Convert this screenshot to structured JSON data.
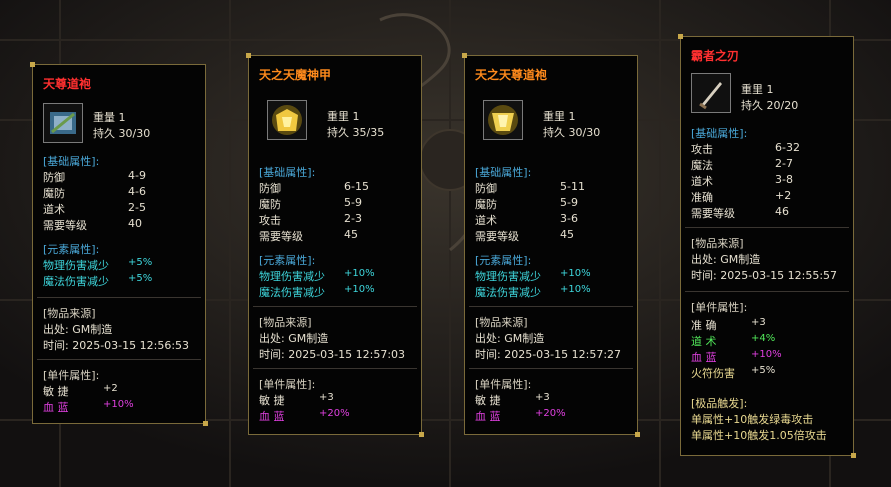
{
  "cards": [
    {
      "title": "天尊道袍",
      "weight": "重量 1",
      "durability": "持久 30/30",
      "base_header": "[基础属性]:",
      "base": [
        {
          "k": "防御",
          "v": "4-9"
        },
        {
          "k": "魔防",
          "v": "4-6"
        },
        {
          "k": "道术",
          "v": "2-5"
        },
        {
          "k": "需要等级",
          "v": "40"
        }
      ],
      "elem_header": "[元素属性]:",
      "elem": [
        {
          "k": "物理伤害减少",
          "v": "+5%"
        },
        {
          "k": "魔法伤害减少",
          "v": "+5%"
        }
      ],
      "source_header": "[物品来源]",
      "source_from": "出处: GM制造",
      "source_time": "时间: 2025-03-15 12:56:53",
      "single_header": "[单件属性]:",
      "single": [
        {
          "k": "敏 捷",
          "v": "+2"
        },
        {
          "k": "血 蓝",
          "v": "+10%"
        }
      ]
    },
    {
      "title": "天之天魔神甲",
      "weight": "重里 1",
      "durability": "持久 35/35",
      "base_header": "[基础属性]:",
      "base": [
        {
          "k": "防御",
          "v": "6-15"
        },
        {
          "k": "魔防",
          "v": "5-9"
        },
        {
          "k": "攻击",
          "v": "2-3"
        },
        {
          "k": "需要等级",
          "v": "45"
        }
      ],
      "elem_header": "[元素属性]:",
      "elem": [
        {
          "k": "物理伤害减少",
          "v": "+10%"
        },
        {
          "k": "魔法伤害减少",
          "v": "+10%"
        }
      ],
      "source_header": "[物品来源]",
      "source_from": "出处: GM制造",
      "source_time": "时间: 2025-03-15 12:57:03",
      "single_header": "[单件属性]:",
      "single": [
        {
          "k": "敏 捷",
          "v": "+3"
        },
        {
          "k": "血 蓝",
          "v": "+20%"
        }
      ]
    },
    {
      "title": "天之天尊道袍",
      "weight": "重里 1",
      "durability": "持久 30/30",
      "base_header": "[基础属性]:",
      "base": [
        {
          "k": "防御",
          "v": "5-11"
        },
        {
          "k": "魔防",
          "v": "5-9"
        },
        {
          "k": "道术",
          "v": "3-6"
        },
        {
          "k": "需要等级",
          "v": "45"
        }
      ],
      "elem_header": "[元素属性]:",
      "elem": [
        {
          "k": "物理伤害减少",
          "v": "+10%"
        },
        {
          "k": "魔法伤害减少",
          "v": "+10%"
        }
      ],
      "source_header": "[物品来源]",
      "source_from": "出处: GM制造",
      "source_time": "时间: 2025-03-15 12:57:27",
      "single_header": "[单件属性]:",
      "single": [
        {
          "k": "敏 捷",
          "v": "+3"
        },
        {
          "k": "血 蓝",
          "v": "+20%"
        }
      ]
    },
    {
      "title": "霸者之刃",
      "weight": "重里 1",
      "durability": "持久 20/20",
      "base_header": "[基础属性]:",
      "base": [
        {
          "k": "攻击",
          "v": "6-32"
        },
        {
          "k": "魔法",
          "v": "2-7"
        },
        {
          "k": "道术",
          "v": "3-8"
        },
        {
          "k": "准确",
          "v": "+2"
        },
        {
          "k": "需要等级",
          "v": "46"
        }
      ],
      "source_header": "[物品来源]",
      "source_from": "出处: GM制造",
      "source_time": "时间: 2025-03-15 12:55:57",
      "single_header": "[单件属性]:",
      "single": [
        {
          "k": "准 确",
          "v": "+3"
        },
        {
          "k": "道 术",
          "v": "+4%"
        },
        {
          "k": "血 蓝",
          "v": "+10%"
        },
        {
          "k": "火符伤害",
          "v": "+5%"
        }
      ],
      "extra_header": "[极品触发]:",
      "extra": [
        "单属性+10触发绿毒攻击",
        "单属性+10触发1.05倍攻击"
      ]
    }
  ]
}
